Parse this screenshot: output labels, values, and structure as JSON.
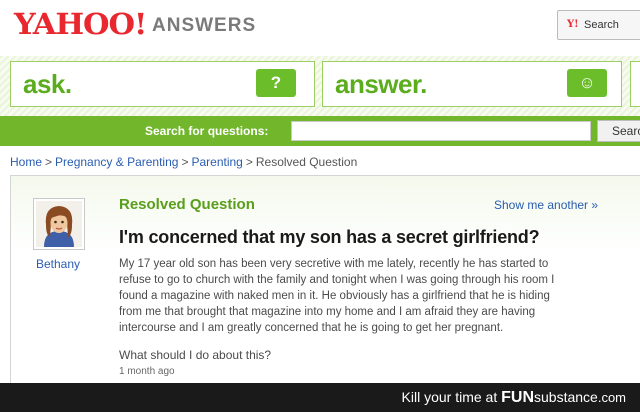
{
  "header": {
    "logo": "YAHOO!",
    "product": "ANSWERS",
    "search_button": "Search"
  },
  "actions": {
    "ask_label": "ask.",
    "ask_glyph": "?",
    "answer_label": "answer.",
    "answer_glyph": "☺"
  },
  "searchbar": {
    "label": "Search for questions:",
    "placeholder": "",
    "button": "Searc"
  },
  "breadcrumb": [
    {
      "label": "Home",
      "link": true
    },
    {
      "label": "Pregnancy & Parenting",
      "link": true
    },
    {
      "label": "Parenting",
      "link": true
    },
    {
      "label": "Resolved Question",
      "link": false
    }
  ],
  "question": {
    "status": "Resolved Question",
    "show_another": "Show me another »",
    "user": "Bethany",
    "title": "I'm concerned that my son has a secret girlfriend?",
    "body_lines": [
      "My 17 year old son has been very secretive with me lately, recently he has started to",
      "refuse to go to church with the family and tonight when I was going through his room I",
      "found a magazine with naked men in it. He obviously has a girlfriend that he is hiding",
      "from me that brought that magazine into my home and I am afraid they are having",
      "intercourse and I am greatly concerned that he is going to get her pregnant."
    ],
    "followup": "What should I do about this?",
    "time": "1 month ago"
  },
  "watermark": {
    "prefix": "Kill your time at",
    "brand_bold": "FUN",
    "brand_rest": "substance",
    "suffix": ".com"
  },
  "colors": {
    "yahoo_red": "#e8282e",
    "green_bar": "#72b62c",
    "green_text": "#5bad1e",
    "link_blue": "#2a5db0"
  }
}
